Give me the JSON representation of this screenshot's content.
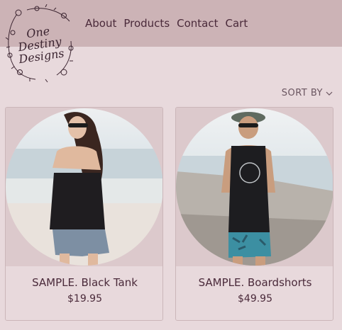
{
  "brand": {
    "logo_text": [
      "One",
      "Destiny",
      "Designs"
    ]
  },
  "nav": {
    "items": [
      "About",
      "Products",
      "Contact",
      "Cart"
    ]
  },
  "sort": {
    "label": "SORT BY",
    "icon": "chevron-down-icon"
  },
  "products": [
    {
      "name": "SAMPLE. Black Tank",
      "price": "$19.95"
    },
    {
      "name": "SAMPLE. Boardshorts",
      "price": "$49.95"
    }
  ],
  "colors": {
    "header_bg": "#ccb3b6",
    "page_bg": "#e8d9dc",
    "text": "#4a2a3a"
  }
}
